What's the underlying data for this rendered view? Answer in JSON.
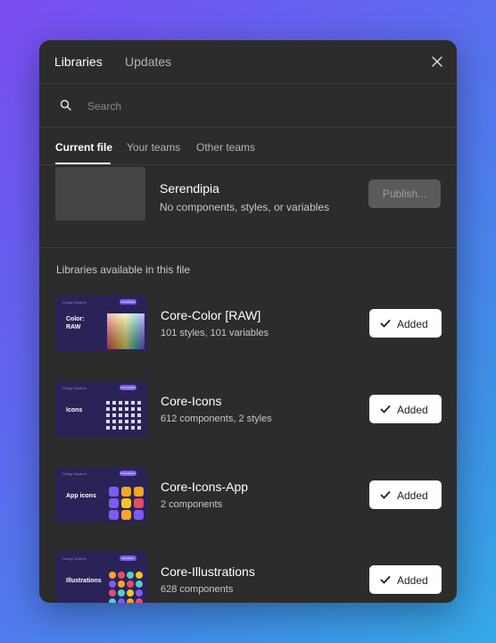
{
  "header": {
    "tabs": [
      "Libraries",
      "Updates"
    ]
  },
  "search": {
    "placeholder": "Search"
  },
  "subtabs": [
    "Current file",
    "Your teams",
    "Other teams"
  ],
  "current_file": {
    "name": "Serendipia",
    "description": "No components, styles, or variables",
    "publish_label": "Publish..."
  },
  "section_label": "Libraries available in this file",
  "libraries": [
    {
      "name": "Core-Color [RAW]",
      "description": "101 styles, 101 variables",
      "button_label": "Added",
      "thumb_title": "Color: RAW",
      "thumb_label": "Design System",
      "thumb_badge": "Foundations"
    },
    {
      "name": "Core-Icons",
      "description": "612 components, 2 styles",
      "button_label": "Added",
      "thumb_title": "Icons",
      "thumb_label": "Design System",
      "thumb_badge": "Iconography"
    },
    {
      "name": "Core-Icons-App",
      "description": "2 components",
      "button_label": "Added",
      "thumb_title": "App icons",
      "thumb_label": "Design System",
      "thumb_badge": "Foundations"
    },
    {
      "name": "Core-Illustrations",
      "description": "628 components",
      "button_label": "Added",
      "thumb_title": "Illustrations",
      "thumb_label": "Design System",
      "thumb_badge": "Illustration"
    }
  ],
  "colors": {
    "panel_bg": "#2c2c2c",
    "thumb_bg": "#2a2358",
    "badge": "#7d5cf0",
    "button_bg": "#ffffff"
  }
}
